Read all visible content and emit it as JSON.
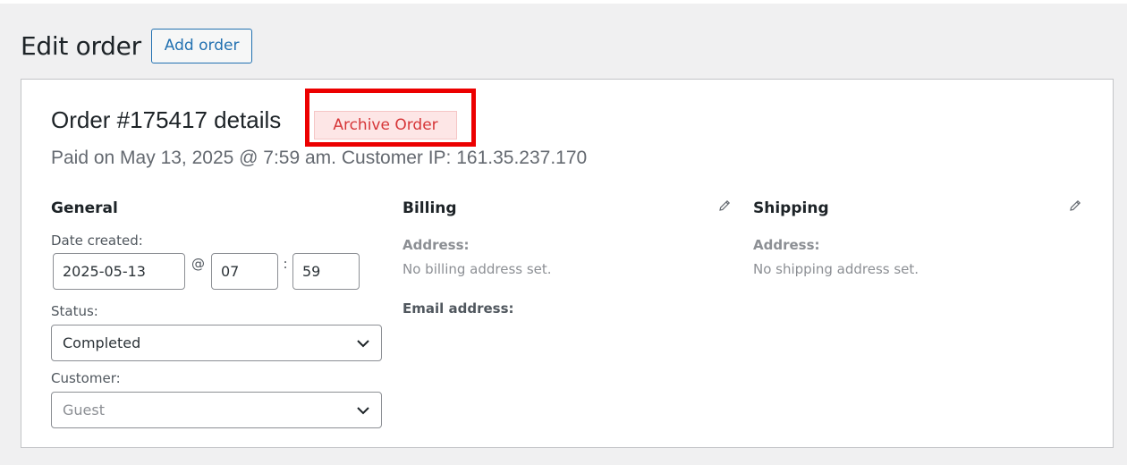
{
  "header": {
    "title": "Edit order",
    "add_order_label": "Add order"
  },
  "order": {
    "title": "Order #175417 details",
    "archive_label": "Archive Order",
    "meta": "Paid on May 13, 2025 @ 7:59 am. Customer IP: 161.35.237.170"
  },
  "general": {
    "heading": "General",
    "date_created_label": "Date created:",
    "date_value": "2025-05-13",
    "at_sep": "@",
    "hour_value": "07",
    "colon_sep": ":",
    "minute_value": "59",
    "status_label": "Status:",
    "status_value": "Completed",
    "customer_label": "Customer:",
    "customer_value": "Guest"
  },
  "billing": {
    "heading": "Billing",
    "address_label": "Address:",
    "address_value": "No billing address set.",
    "email_label": "Email address:"
  },
  "shipping": {
    "heading": "Shipping",
    "address_label": "Address:",
    "address_value": "No shipping address set."
  },
  "colors": {
    "accent": "#2271b1",
    "archive_text": "#d63638",
    "archive_bg": "#fde6e6",
    "highlight_box": "#ec0000"
  },
  "icons": {
    "billing_edit": "pencil-icon",
    "shipping_edit": "pencil-icon",
    "select_arrow": "chevron-down-icon"
  }
}
